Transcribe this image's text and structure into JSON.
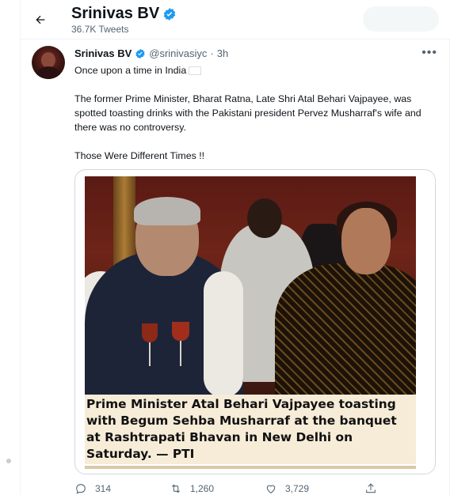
{
  "header": {
    "title": "Srinivas BV",
    "tweets_count": "36.7K Tweets"
  },
  "tweet": {
    "author_name": "Srinivas BV",
    "handle": "@srinivasiyc",
    "separator": "·",
    "time": "3h",
    "more_label": "•••",
    "line1": "Once upon a time in India",
    "flag_icon": "india-flag-emoji",
    "paragraph2": "The former Prime Minister, Bharat Ratna, Late Shri Atal Behari Vajpayee, was spotted toasting drinks with the Pakistani president Pervez Musharraf's wife and there was no controversy.",
    "paragraph3": "Those Were Different Times !!",
    "media_caption": "Prime Minister Atal Behari Vajpayee toasting with Begum Sehba Musharraf at the banquet at Rashtrapati Bhavan in New Delhi on Saturday. — PTI"
  },
  "actions": {
    "reply_count": "314",
    "retweet_count": "1,260",
    "like_count": "3,729"
  },
  "colors": {
    "verified": "#1d9bf0",
    "muted_text": "#536471",
    "caption_bg": "#f6ecd8"
  }
}
